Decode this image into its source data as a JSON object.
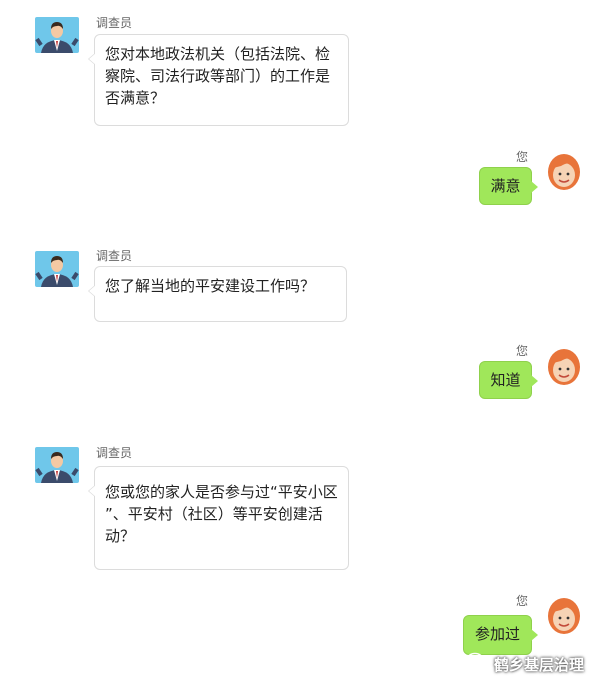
{
  "messages": [
    {
      "side": "left",
      "sender": "调查员",
      "text": "您对本地政法机关（包括法院、检察院、司法行政等部门）的工作是否满意？"
    },
    {
      "side": "right",
      "sender": "您",
      "text": "满意"
    },
    {
      "side": "left",
      "sender": "调查员",
      "text": "您了解当地的平安建设工作吗？"
    },
    {
      "side": "right",
      "sender": "您",
      "text": "知道"
    },
    {
      "side": "left",
      "sender": "调查员",
      "text": "您或您的家人是否参与过“平安小区 ”、平安村（社区）等平安创建活动？"
    },
    {
      "side": "right",
      "sender": "您",
      "text": "参加过"
    }
  ],
  "watermark": {
    "text": "鹤乡基层治理",
    "icon": "wechat-icon"
  },
  "colors": {
    "bubble_right": "#a0e75a",
    "bubble_left_border": "#dcdcdc"
  }
}
